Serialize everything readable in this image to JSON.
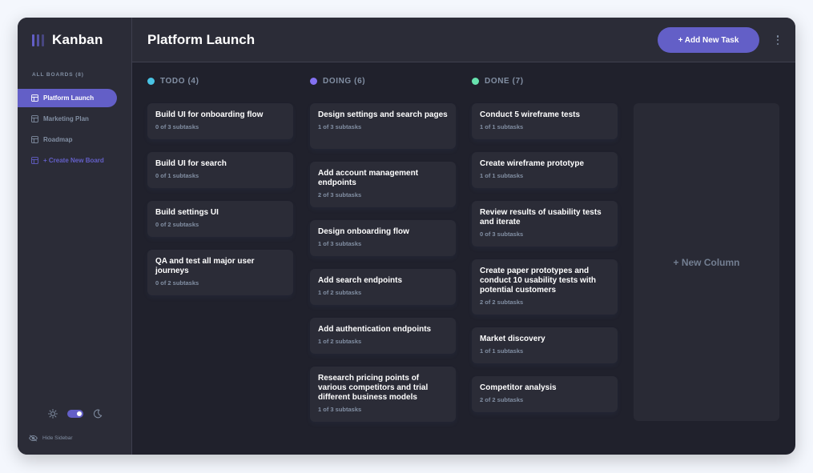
{
  "app": {
    "name": "Kanban"
  },
  "sidebar": {
    "boards_heading": "ALL BOARDS (8)",
    "boards": [
      {
        "label": "Platform Launch",
        "active": true
      },
      {
        "label": "Marketing Plan",
        "active": false
      },
      {
        "label": "Roadmap",
        "active": false
      }
    ],
    "create_label": "+ Create New Board",
    "hide_label": "Hide Sidebar",
    "theme": "dark"
  },
  "header": {
    "title": "Platform Launch",
    "add_task_label": "+ Add New Task"
  },
  "columns": [
    {
      "label": "TODO (4)",
      "color": "#49c4e5",
      "cards": [
        {
          "title": "Build UI for onboarding flow",
          "subtasks": "0 of 3 subtasks"
        },
        {
          "title": "Build UI for search",
          "subtasks": "0 of 1 subtasks"
        },
        {
          "title": "Build settings UI",
          "subtasks": "0 of 2 subtasks"
        },
        {
          "title": "QA and test all major user journeys",
          "subtasks": "0 of 2 subtasks"
        }
      ]
    },
    {
      "label": "DOING (6)",
      "color": "#8471f2",
      "cards": [
        {
          "title": "Design settings and search pages",
          "subtasks": "1 of 3 subtasks"
        },
        {
          "title": "Add account management endpoints",
          "subtasks": "2 of 3 subtasks"
        },
        {
          "title": "Design onboarding flow",
          "subtasks": "1 of 3 subtasks"
        },
        {
          "title": "Add search endpoints",
          "subtasks": "1 of 2 subtasks"
        },
        {
          "title": "Add authentication endpoints",
          "subtasks": "1 of 2 subtasks"
        },
        {
          "title": "Research pricing points of various competitors and trial different business models",
          "subtasks": "1 of 3 subtasks"
        }
      ]
    },
    {
      "label": "DONE (7)",
      "color": "#67e2ae",
      "cards": [
        {
          "title": "Conduct 5 wireframe tests",
          "subtasks": "1 of 1 subtasks"
        },
        {
          "title": "Create wireframe prototype",
          "subtasks": "1 of 1 subtasks"
        },
        {
          "title": "Review results of usability tests and iterate",
          "subtasks": "0 of 3 subtasks"
        },
        {
          "title": "Create paper prototypes and conduct 10 usability tests with potential customers",
          "subtasks": "2 of 2 subtasks"
        },
        {
          "title": "Market discovery",
          "subtasks": "1 of 1 subtasks"
        },
        {
          "title": "Competitor analysis",
          "subtasks": "2 of 2 subtasks"
        }
      ]
    }
  ],
  "new_column_label": "+ New Column",
  "colors": {
    "accent": "#635fc7",
    "background": "#20212c",
    "surface": "#2b2c37",
    "muted_text": "#828fa3"
  }
}
